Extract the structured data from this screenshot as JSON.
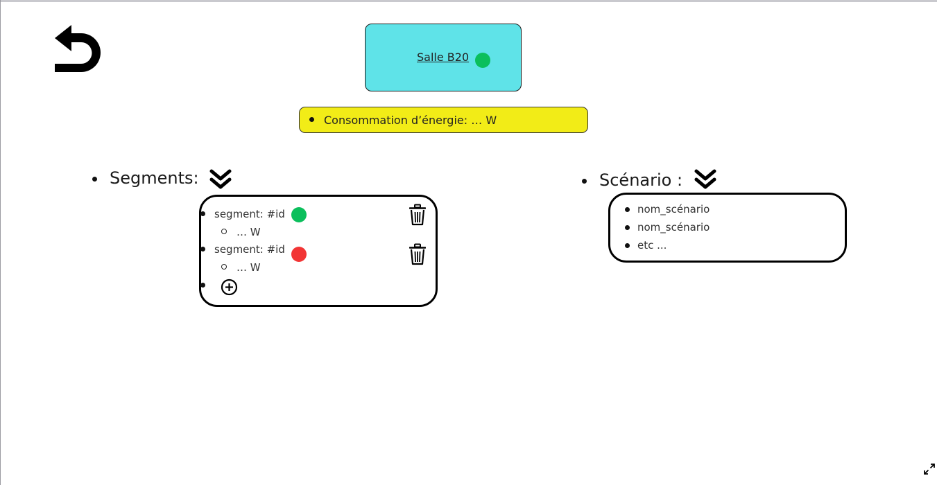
{
  "room": {
    "name": "Salle B20",
    "status_color": "#0bbf5c"
  },
  "energy": {
    "text": "Consommation d’énergie: … W"
  },
  "segments": {
    "title": "Segments:",
    "items": [
      {
        "label": "segment: #id",
        "status_color": "#0bbf5c",
        "power": "… W"
      },
      {
        "label": "segment: #id",
        "status_color": "#f23535",
        "power": "… W"
      }
    ]
  },
  "scenario": {
    "title": "Scénario :",
    "items": [
      "nom_scénario",
      "nom_scénario",
      "etc ..."
    ]
  },
  "colors": {
    "room_card_bg": "#5fe3e8",
    "energy_bar_bg": "#f2ec17",
    "status_on": "#0bbf5c",
    "status_off": "#f23535"
  },
  "icons": {
    "back": "back-arrow-icon",
    "chevron": "double-chevron-down-icon",
    "trash": "trash-icon",
    "add": "plus-circle-icon",
    "expand": "expand-icon"
  }
}
